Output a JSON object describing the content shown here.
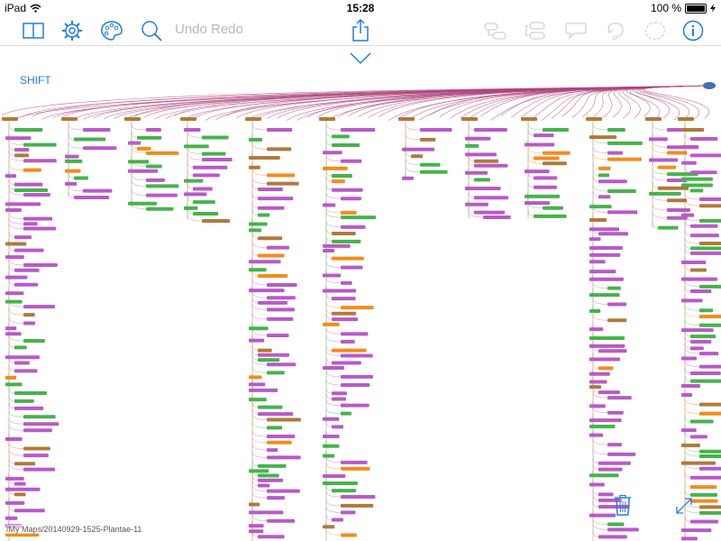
{
  "status_bar": {
    "device": "iPad",
    "time": "15:28",
    "battery": "100 %"
  },
  "toolbar": {
    "undo_label": "Undo",
    "redo_label": "Redo"
  },
  "map": {
    "shift_label": "SHIFT",
    "file_path": "/My Maps/20140929-1525-Plantae-11"
  },
  "colors": {
    "accent": "#1f7ee0",
    "branch": "#b0457e",
    "brown": "#b07a3c",
    "green": "#46b34c",
    "purple": "#b85ac8",
    "orange": "#f28c1c",
    "root": "#3f6fb5"
  },
  "icons": {
    "book": "book-icon",
    "settings": "gear-icon",
    "palette": "palette-icon",
    "search": "search-icon",
    "share": "share-icon",
    "info": "info-icon",
    "trash": "trash-icon",
    "expand": "expand-icon"
  }
}
